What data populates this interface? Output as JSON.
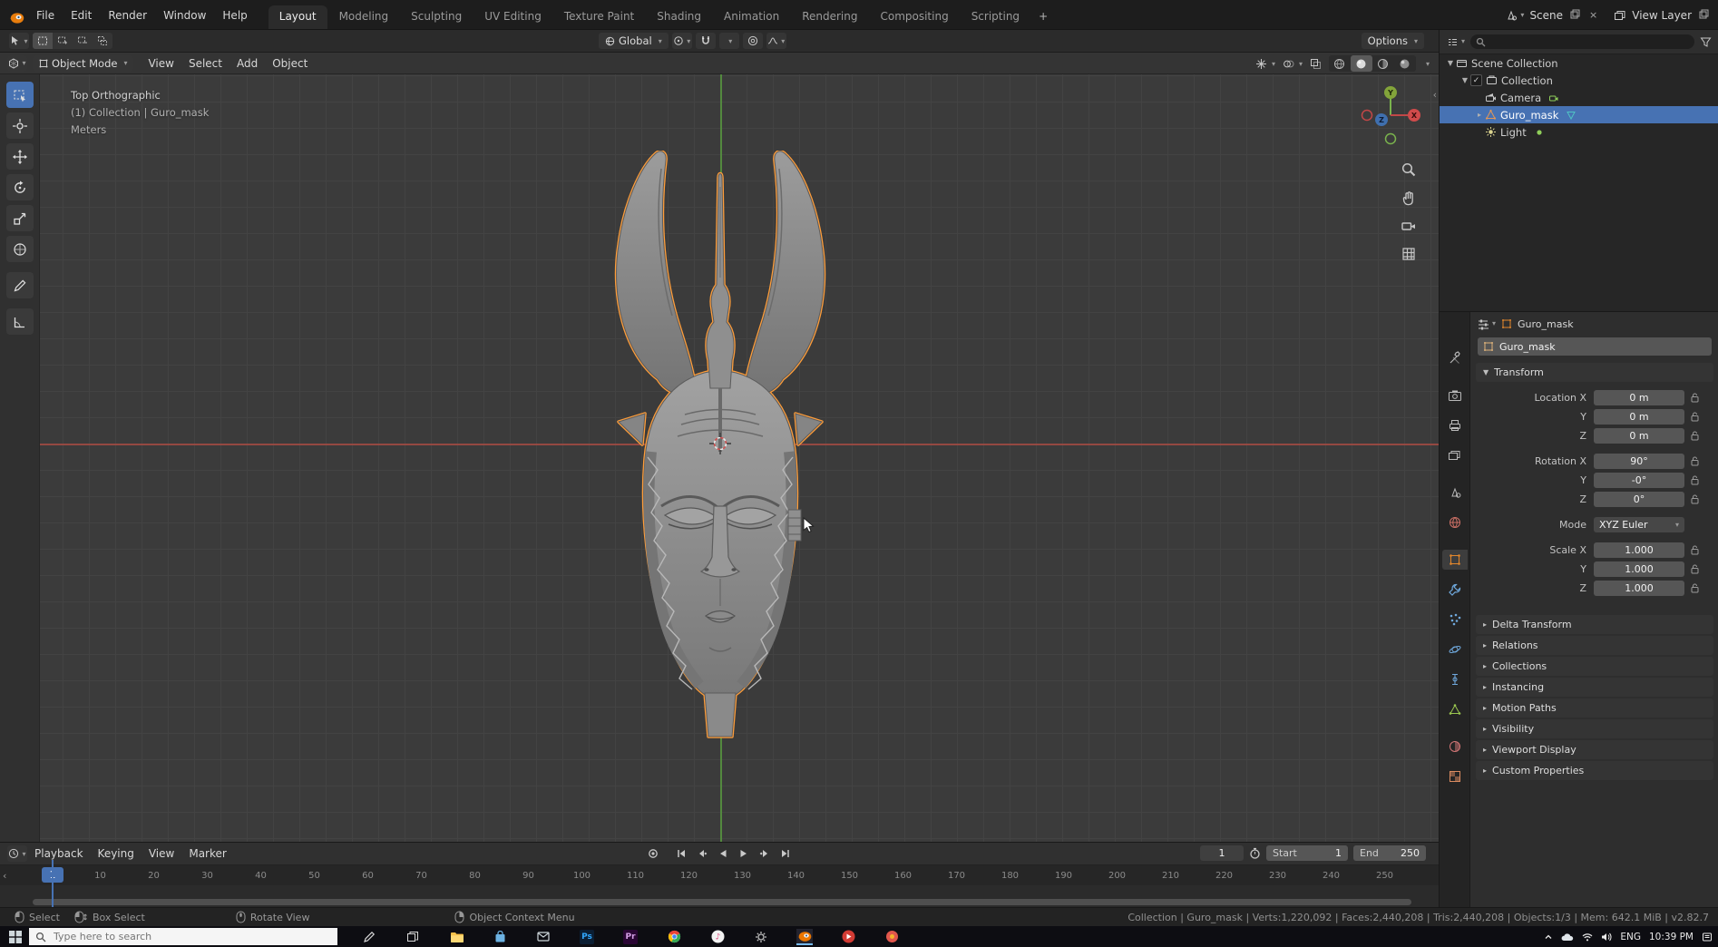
{
  "topbar": {
    "menus": [
      "File",
      "Edit",
      "Render",
      "Window",
      "Help"
    ],
    "workspaces": [
      "Layout",
      "Modeling",
      "Sculpting",
      "UV Editing",
      "Texture Paint",
      "Shading",
      "Animation",
      "Rendering",
      "Compositing",
      "Scripting"
    ],
    "active_workspace": "Layout",
    "new_workspace_button": "+",
    "scene_name": "Scene",
    "view_layer_name": "View Layer"
  },
  "tool_settings": {
    "orientation": "Global",
    "options_label": "Options"
  },
  "viewport_header": {
    "mode": "Object Mode",
    "menus": [
      "View",
      "Select",
      "Add",
      "Object"
    ]
  },
  "tools": [
    "box-select",
    "cursor",
    "move",
    "rotate",
    "scale",
    "transform",
    "annotate",
    "measure"
  ],
  "viewport": {
    "overlay_line1": "Top Orthographic",
    "overlay_line2": "(1) Collection | Guro_mask",
    "overlay_line3": "Meters",
    "gizmo": {
      "x": "X",
      "y": "Y",
      "z": "Z"
    }
  },
  "outliner": {
    "rows": [
      {
        "label": "Scene Collection",
        "icon": "scene-collection",
        "depth": 0,
        "disclosure": "▼"
      },
      {
        "label": "Collection",
        "icon": "collection",
        "depth": 1,
        "disclosure": "▼",
        "checkbox": true
      },
      {
        "label": "Camera",
        "icon": "camera",
        "badge": "camera-data",
        "depth": 2
      },
      {
        "label": "Guro_mask",
        "icon": "mesh",
        "badge": "mesh-data",
        "depth": 2,
        "disclosure": "▸",
        "selected": true
      },
      {
        "label": "Light",
        "icon": "light",
        "badge": "light-data",
        "depth": 2
      }
    ]
  },
  "properties": {
    "tabs": [
      "tool",
      "render",
      "output",
      "view-layer",
      "scene",
      "world",
      "object",
      "modifiers",
      "particles",
      "physics",
      "constraints",
      "object-data",
      "material",
      "texture"
    ],
    "active_tab": "object",
    "breadcrumb": "Guro_mask",
    "object_name": "Guro_mask",
    "transform": {
      "title": "Transform",
      "rows": [
        {
          "label": "Location X",
          "value": "0 m",
          "lock": true
        },
        {
          "label": "Y",
          "value": "0 m",
          "lock": true
        },
        {
          "label": "Z",
          "value": "0 m",
          "lock": true,
          "gap": true
        },
        {
          "label": "Rotation X",
          "value": "90°",
          "lock": true
        },
        {
          "label": "Y",
          "value": "-0°",
          "lock": true
        },
        {
          "label": "Z",
          "value": "0°",
          "lock": true,
          "gap": true
        },
        {
          "label": "Mode",
          "value": "XYZ Euler",
          "dropdown": true,
          "gap": true
        },
        {
          "label": "Scale X",
          "value": "1.000",
          "lock": true
        },
        {
          "label": "Y",
          "value": "1.000",
          "lock": true
        },
        {
          "label": "Z",
          "value": "1.000",
          "lock": true
        }
      ]
    },
    "collapsed_sections": [
      "Delta Transform",
      "Relations",
      "Collections",
      "Instancing",
      "Motion Paths",
      "Visibility",
      "Viewport Display",
      "Custom Properties"
    ]
  },
  "timeline": {
    "menus": [
      "Playback",
      "Keying",
      "View",
      "Marker"
    ],
    "playback_controls": [
      "auto-key",
      "jump-start",
      "prev-keyframe",
      "play-reverse",
      "play",
      "next-keyframe",
      "jump-end"
    ],
    "current_frame": "1",
    "frame_ticks": [
      "10",
      "20",
      "30",
      "40",
      "50",
      "60",
      "70",
      "80",
      "90",
      "100",
      "110",
      "120",
      "130",
      "140",
      "150",
      "160",
      "170",
      "180",
      "190",
      "200",
      "210",
      "220",
      "230",
      "240",
      "250"
    ],
    "start_label": "Start",
    "start_value": "1",
    "end_label": "End",
    "end_value": "250"
  },
  "statusbar": {
    "hints": [
      {
        "icon": "mouse-left",
        "label": "Select"
      },
      {
        "icon": "mouse-left-drag",
        "label": "Box Select"
      },
      {
        "icon": "mouse-middle",
        "label": "Rotate View"
      },
      {
        "icon": "mouse-right",
        "label": "Object Context Menu"
      }
    ],
    "stats": "Collection | Guro_mask | Verts:1,220,092 | Faces:2,440,208 | Tris:2,440,208 | Objects:1/3 | Mem: 642.1 MiB | v2.82.7"
  },
  "taskbar": {
    "search_placeholder": "Type here to search",
    "apps": [
      {
        "name": "ink-workspace",
        "glyph": "pen"
      },
      {
        "name": "task-view",
        "glyph": "layers"
      },
      {
        "name": "file-explorer",
        "glyph": "folder"
      },
      {
        "name": "store",
        "glyph": "bag"
      },
      {
        "name": "mail",
        "glyph": "mail"
      },
      {
        "name": "photoshop",
        "glyph": "Ps",
        "bg": "#0b1e33",
        "fg": "#31a8ff"
      },
      {
        "name": "premiere",
        "glyph": "Pr",
        "bg": "#2a0634",
        "fg": "#d6a1e8"
      },
      {
        "name": "chrome",
        "glyph": "chrome"
      },
      {
        "name": "music",
        "glyph": "note"
      },
      {
        "name": "settings",
        "glyph": "gear"
      },
      {
        "name": "blender",
        "glyph": "blender",
        "active": true
      },
      {
        "name": "media-red",
        "glyph": "play"
      },
      {
        "name": "media-orange",
        "glyph": "dot"
      }
    ],
    "tray": {
      "language": "ENG",
      "time": "10:39 PM"
    }
  }
}
